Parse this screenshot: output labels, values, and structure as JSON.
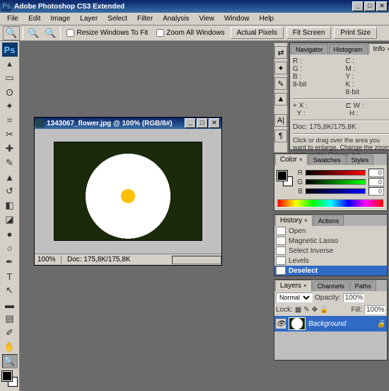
{
  "app": {
    "title": "Adobe Photoshop CS3 Extended",
    "icon": "Ps"
  },
  "menu": [
    "File",
    "Edit",
    "Image",
    "Layer",
    "Select",
    "Filter",
    "Analysis",
    "View",
    "Window",
    "Help"
  ],
  "options": {
    "resize": "Resize Windows To Fit",
    "zoomall": "Zoom All Windows",
    "actual": "Actual Pixels",
    "fit": "Fit Screen",
    "print": "Print Size"
  },
  "doc": {
    "title": "1343067_flower.jpg @ 100% (RGB/8#)",
    "zoom": "100%",
    "status": "Doc: 175,8K/175,8K"
  },
  "info": {
    "tabs": [
      "Navigator",
      "Histogram",
      "Info"
    ],
    "r": "R :",
    "g": "G :",
    "b": "B :",
    "bits1": "8-bit",
    "c": "C :",
    "m": "M :",
    "y2": "Y :",
    "k": "K :",
    "bits2": "8-bit",
    "x": "X :",
    "y": "Y :",
    "w": "W :",
    "h": "H :",
    "docline": "Doc: 175,8K/175,8K",
    "hint": "Click or drag over the area you want to enlarge. Change the zoom state on the Options bar."
  },
  "color": {
    "tabs": [
      "Color",
      "Swatches",
      "Styles"
    ],
    "r": "R",
    "g": "G",
    "b": "B",
    "v": "0"
  },
  "history": {
    "tabs": [
      "History",
      "Actions"
    ],
    "items": [
      "Open",
      "Magnetic Lasso",
      "Select Inverse",
      "Levels",
      "Deselect"
    ]
  },
  "layers": {
    "tabs": [
      "Layers",
      "Channels",
      "Paths"
    ],
    "mode": "Normal",
    "opacityLabel": "Opacity:",
    "opacity": "100%",
    "lockLabel": "Lock:",
    "fillLabel": "Fill:",
    "fill": "100%",
    "bg": "Background"
  }
}
